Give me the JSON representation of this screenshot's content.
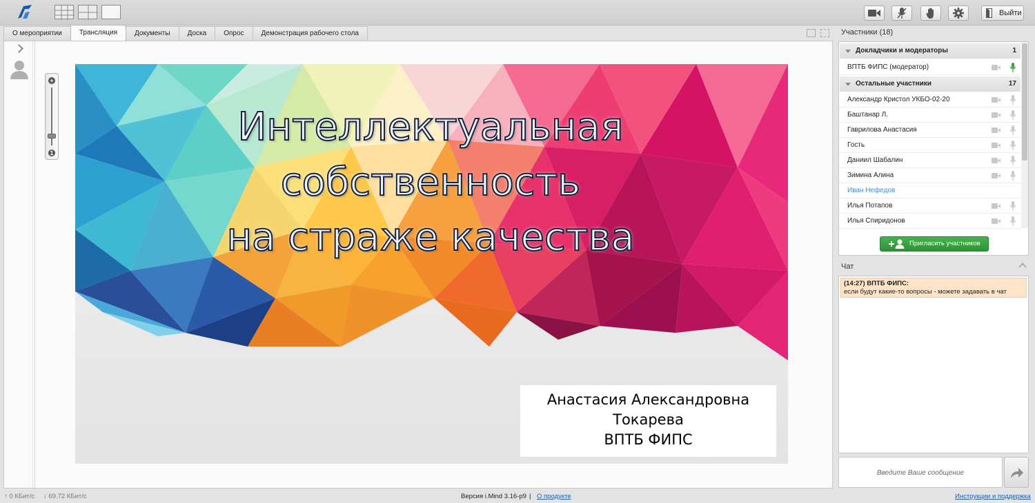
{
  "toolbar": {
    "exit_label": "Выйти"
  },
  "tabs": [
    {
      "label": "О мероприятии"
    },
    {
      "label": "Трансляция"
    },
    {
      "label": "Документы"
    },
    {
      "label": "Доска"
    },
    {
      "label": "Опрос"
    },
    {
      "label": "Демонстрация рабочего стола"
    }
  ],
  "slide": {
    "title_lines": [
      "Интеллектуальная",
      "собственность",
      "на страже качества"
    ],
    "author_lines": [
      "Анастасия Александровна",
      "Токарева",
      "ВПТБ ФИПС"
    ]
  },
  "participants": {
    "header": "Участники (18)",
    "groups": [
      {
        "name": "Докладчики и модераторы",
        "count": "1"
      },
      {
        "name": "Остальные участники",
        "count": "17"
      }
    ],
    "moderators": [
      {
        "name": "ВПТБ ФИПС (модератор)"
      }
    ],
    "others": [
      {
        "name": "Александр Кристол УКБО-02-20"
      },
      {
        "name": "Баштанар Л."
      },
      {
        "name": "Гаврилова Анастасия"
      },
      {
        "name": "Гость"
      },
      {
        "name": "Даниил Шабалин"
      },
      {
        "name": "Зимина Алина"
      },
      {
        "name": "Иван Нефедов"
      },
      {
        "name": "Илья Потапов"
      },
      {
        "name": "Илья Спиридонов"
      }
    ],
    "invite_label": "Пригласить участников"
  },
  "chat": {
    "header": "Чат",
    "messages": [
      {
        "meta": "(14:27) ВПТБ ФИПС:",
        "text": "если будут какие-то вопросы - можете задавать в чат"
      }
    ],
    "input_placeholder": "Введите Ваше сообщение"
  },
  "status": {
    "upload": "0 КБит/с",
    "download": "69.72 КБит/с",
    "version": "Версия i.Mind 3.16-p9",
    "separator": "|",
    "about_link": "О продукте",
    "help_link": "Инструкции и поддержка"
  },
  "colors": {
    "accent_green": "#2f9236",
    "mic_active": "#3aa63a",
    "link": "#3b8fd6",
    "chat_highlight": "#fde3c7"
  }
}
